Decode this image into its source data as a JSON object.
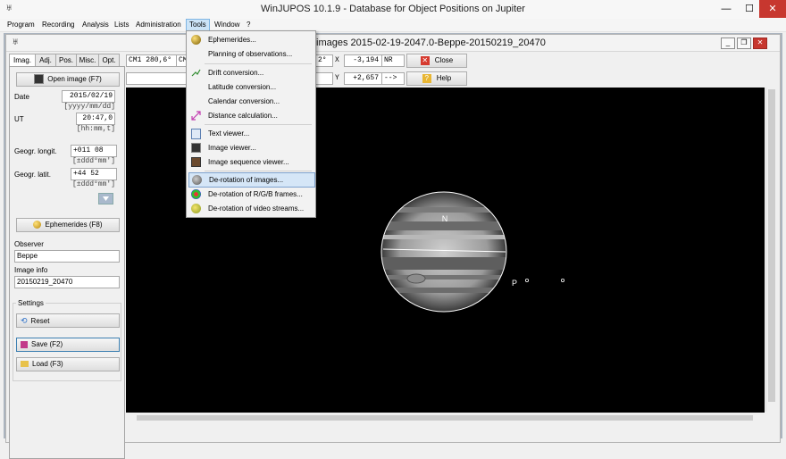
{
  "window": {
    "title": "WinJUPOS 10.1.9 - Database for Object Positions on Jupiter",
    "minimize": "—",
    "maximize": "☐",
    "close": "✕"
  },
  "menubar": {
    "items": [
      "Program",
      "Recording",
      "Analysis",
      "Lists",
      "Administration",
      "Tools",
      "Window",
      "?"
    ],
    "open": "Tools"
  },
  "tools_menu": {
    "items": [
      {
        "label": "Ephemerides...",
        "icon": "ephemerides-icon"
      },
      {
        "label": "Planning of observations...",
        "icon": ""
      },
      {
        "label": "Drift conversion...",
        "icon": "drift-icon"
      },
      {
        "label": "Latitude conversion...",
        "icon": ""
      },
      {
        "label": "Calendar conversion...",
        "icon": ""
      },
      {
        "label": "Distance calculation...",
        "icon": "distance-icon"
      },
      {
        "label": "Text viewer...",
        "icon": "text-viewer-icon"
      },
      {
        "label": "Image viewer...",
        "icon": "image-viewer-icon"
      },
      {
        "label": "Image sequence viewer...",
        "icon": "sequence-icon"
      },
      {
        "label": "De-rotation of images...",
        "icon": "derotation-icon"
      },
      {
        "label": "De-rotation of R/G/B frames...",
        "icon": "rgb-icon"
      },
      {
        "label": "De-rotation of video streams...",
        "icon": "video-icon"
      }
    ],
    "highlighted": "De-rotation of images..."
  },
  "child_window": {
    "title": "images  2015-02-19-2047.0-Beppe-20150219_20470"
  },
  "tabs": [
    "Imag.",
    "Adj.",
    "Pos.",
    "Misc.",
    "Opt."
  ],
  "left_panel": {
    "open_image_button": "Open image (F7)",
    "date_label": "Date",
    "date_value": "2015/02/19",
    "date_hint": "[yyyy/mm/dd]",
    "ut_label": "UT",
    "ut_value": "20:47,0",
    "ut_hint": "[hh:mm,t]",
    "long_label": "Geogr. longit.",
    "long_value": "+011 08",
    "long_hint": "[±ddd°mm']",
    "lat_label": "Geogr. latit.",
    "lat_value": "+44 52",
    "lat_hint": "[±ddd°mm']",
    "ephemerides_button": "Ephemerides (F8)",
    "observer_label": "Observer",
    "observer_value": "Beppe",
    "image_info_label": "Image info",
    "image_info_value": "20150219_20470",
    "settings_label": "Settings",
    "reset_button": "Reset",
    "save_button": "Save (F2)",
    "load_button": "Load (F3)"
  },
  "toolbar": {
    "cm1": "CM1 280,6°",
    "cm_partial": "CM",
    "angle_partial": "2°",
    "x_label": "X",
    "x_value": "-3,194",
    "nr": "NR",
    "y_label": "Y",
    "y_value": "+2,657",
    "arrow": "-->",
    "close_button": "Close",
    "help_button": "Help"
  },
  "image": {
    "north_label": "N",
    "p_label": "P"
  },
  "colors": {
    "accent": "#cce4f7",
    "highlight": "#d5e6f7",
    "mdi_background": "#abb4bf"
  }
}
